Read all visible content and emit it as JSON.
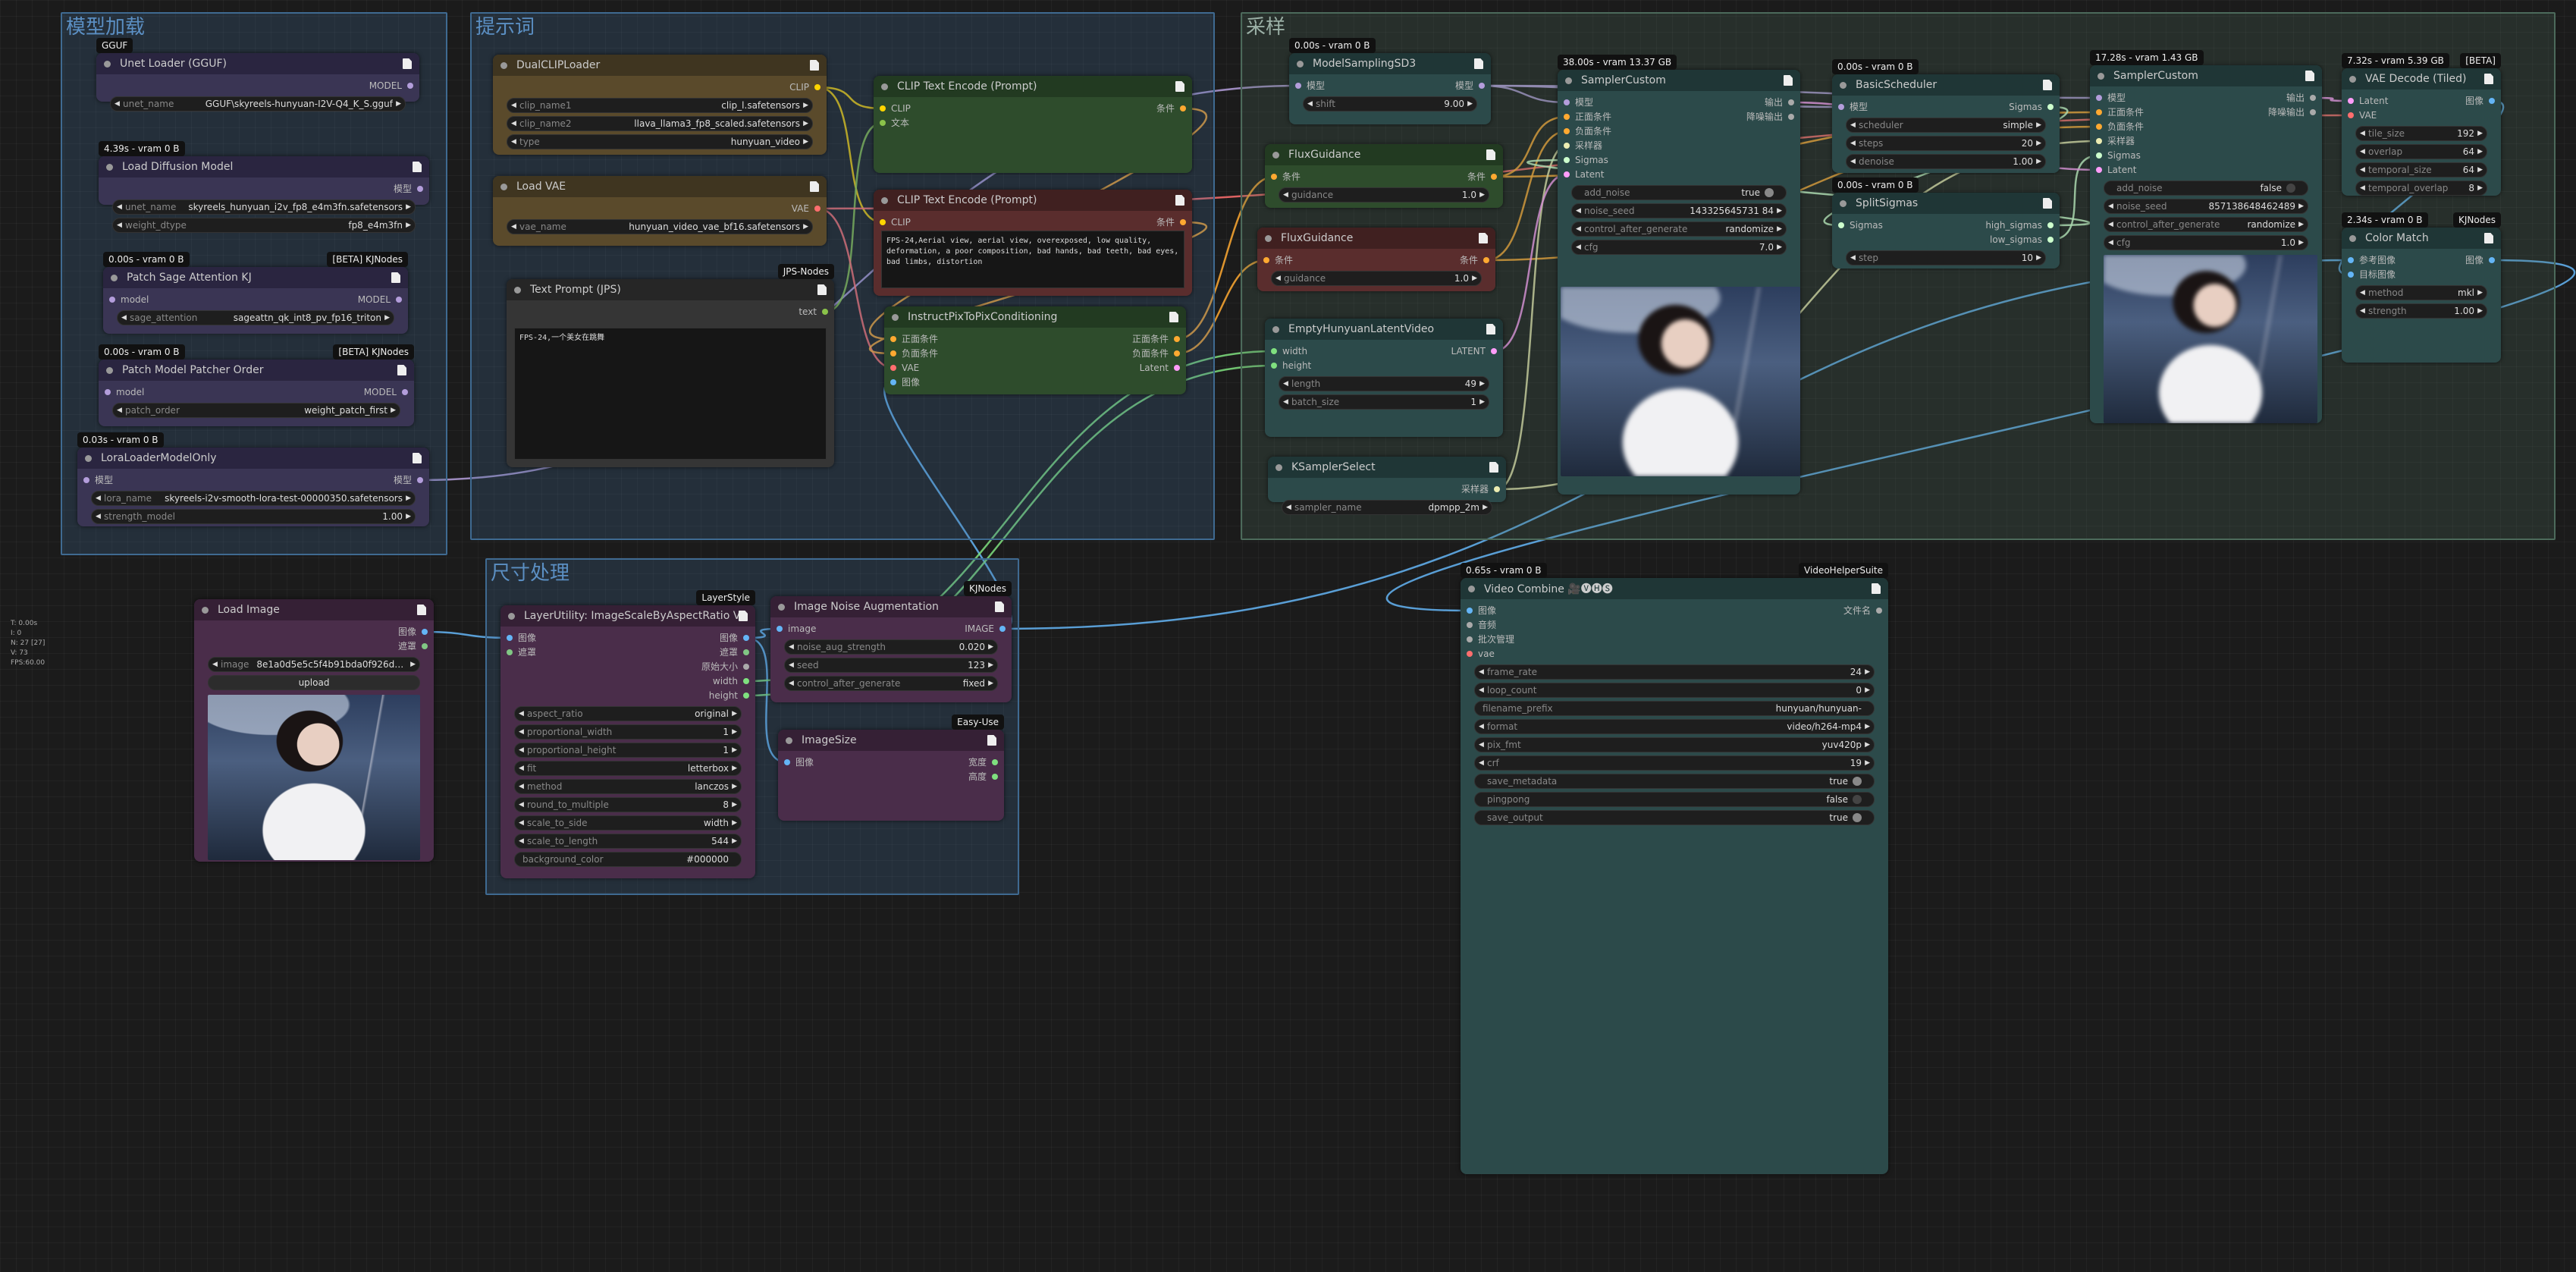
{
  "groups": [
    {
      "id": "g1",
      "title": "模型加载",
      "color": "#3f6a91"
    },
    {
      "id": "g2",
      "title": "提示词",
      "color": "#3f6a91"
    },
    {
      "id": "g3",
      "title": "采样",
      "color": "#4c6a5b"
    },
    {
      "id": "g4",
      "title": "尺寸处理",
      "color": "#3f6a91"
    }
  ],
  "nodes": [
    {
      "key": "unet_loader",
      "title": "Unet Loader (GGUF)",
      "badge": "GGUF",
      "outputs": [
        "MODEL"
      ],
      "widgets": [
        {
          "name": "unet_name",
          "value": "GGUF\\skyreels-hunyuan-I2V-Q4_K_S.gguf"
        }
      ]
    },
    {
      "key": "load_diffusion",
      "title": "Load Diffusion Model",
      "badge": "4.39s - vram 0 B",
      "outputs": [
        "模型"
      ],
      "widgets": [
        {
          "name": "unet_name",
          "value": "skyreels_hunyuan_i2v_fp8_e4m3fn.safetensors"
        },
        {
          "name": "weight_dtype",
          "value": "fp8_e4m3fn"
        }
      ]
    },
    {
      "key": "patch_sage",
      "title": "Patch Sage Attention KJ",
      "badge": "0.00s - vram 0 B",
      "badge2": "[BETA] KJNodes",
      "inputs": [
        "model"
      ],
      "outputs": [
        "MODEL"
      ],
      "widgets": [
        {
          "name": "sage_attention",
          "value": "sageattn_qk_int8_pv_fp16_triton"
        }
      ]
    },
    {
      "key": "patch_order",
      "title": "Patch Model Patcher Order",
      "badge": "0.00s - vram 0 B",
      "badge2": "[BETA] KJNodes",
      "inputs": [
        "model"
      ],
      "outputs": [
        "MODEL"
      ],
      "widgets": [
        {
          "name": "patch_order",
          "value": "weight_patch_first"
        }
      ]
    },
    {
      "key": "lora",
      "title": "LoraLoaderModelOnly",
      "badge": "0.03s - vram 0 B",
      "inputs": [
        "模型"
      ],
      "outputs": [
        "模型"
      ],
      "widgets": [
        {
          "name": "lora_name",
          "value": "skyreels-i2v-smooth-lora-test-00000350.safetensors"
        },
        {
          "name": "strength_model",
          "value": "1.00"
        }
      ]
    },
    {
      "key": "dualclip",
      "title": "DualCLIPLoader",
      "outputs": [
        "CLIP"
      ],
      "widgets": [
        {
          "name": "clip_name1",
          "value": "clip_l.safetensors"
        },
        {
          "name": "clip_name2",
          "value": "llava_llama3_fp8_scaled.safetensors"
        },
        {
          "name": "type",
          "value": "hunyuan_video"
        }
      ]
    },
    {
      "key": "load_vae",
      "title": "Load VAE",
      "outputs": [
        "VAE"
      ],
      "widgets": [
        {
          "name": "vae_name",
          "value": "hunyuan_video_vae_bf16.safetensors"
        }
      ]
    },
    {
      "key": "text_prompt",
      "title": "Text Prompt (JPS)",
      "badge2": "JPS-Nodes",
      "outputs": [
        "text"
      ],
      "text": "FPS-24,一个美女在跳舞"
    },
    {
      "key": "clip_pos",
      "title": "CLIP Text Encode (Prompt)",
      "inputs": [
        "CLIP",
        "文本"
      ],
      "outputs": [
        "条件"
      ]
    },
    {
      "key": "clip_neg",
      "title": "CLIP Text Encode (Prompt)",
      "inputs": [
        "CLIP"
      ],
      "outputs": [
        "条件"
      ],
      "text": "FPS-24,Aerial view, aerial view, overexposed, low quality, deformation, a poor composition, bad hands, bad teeth, bad eyes, bad limbs, distortion"
    },
    {
      "key": "instruct",
      "title": "InstructPixToPixConditioning",
      "inputs": [
        "正面条件",
        "负面条件",
        "VAE",
        "图像"
      ],
      "outputs": [
        "正面条件",
        "负面条件",
        "Latent"
      ]
    },
    {
      "key": "msd3",
      "title": "ModelSamplingSD3",
      "badge": "0.00s - vram 0 B",
      "inputs": [
        "模型"
      ],
      "outputs": [
        "模型"
      ],
      "widgets": [
        {
          "name": "shift",
          "value": "9.00"
        }
      ]
    },
    {
      "key": "flux1",
      "title": "FluxGuidance",
      "inputs": [
        "条件"
      ],
      "outputs": [
        "条件"
      ],
      "widgets": [
        {
          "name": "guidance",
          "value": "1.0"
        }
      ]
    },
    {
      "key": "flux2",
      "title": "FluxGuidance",
      "inputs": [
        "条件"
      ],
      "outputs": [
        "条件"
      ],
      "widgets": [
        {
          "name": "guidance",
          "value": "1.0"
        }
      ]
    },
    {
      "key": "empty_latent",
      "title": "EmptyHunyuanLatentVideo",
      "inputs": [
        "width",
        "height"
      ],
      "outputs": [
        "LATENT"
      ],
      "widgets": [
        {
          "name": "length",
          "value": "49"
        },
        {
          "name": "batch_size",
          "value": "1"
        }
      ]
    },
    {
      "key": "ksel",
      "title": "KSamplerSelect",
      "outputs": [
        "采样器"
      ],
      "widgets": [
        {
          "name": "sampler_name",
          "value": "dpmpp_2m"
        }
      ]
    },
    {
      "key": "sc1",
      "title": "SamplerCustom",
      "badge": "38.00s - vram 13.37 GB",
      "inputs": [
        "模型",
        "正面条件",
        "负面条件",
        "采样器",
        "Sigmas",
        "Latent"
      ],
      "outputs": [
        "输出",
        "降噪输出"
      ],
      "widgets": [
        {
          "name": "add_noise",
          "value": "true",
          "toggle": true
        },
        {
          "name": "noise_seed",
          "value": "143325645731 84"
        },
        {
          "name": "control_after_generate",
          "value": "randomize"
        },
        {
          "name": "cfg",
          "value": "7.0"
        }
      ]
    },
    {
      "key": "bsched",
      "title": "BasicScheduler",
      "badge": "0.00s - vram 0 B",
      "inputs": [
        "模型"
      ],
      "outputs": [
        "Sigmas"
      ],
      "widgets": [
        {
          "name": "scheduler",
          "value": "simple"
        },
        {
          "name": "steps",
          "value": "20"
        },
        {
          "name": "denoise",
          "value": "1.00"
        }
      ]
    },
    {
      "key": "split",
      "title": "SplitSigmas",
      "badge": "0.00s - vram 0 B",
      "inputs": [
        "Sigmas"
      ],
      "outputs": [
        "high_sigmas",
        "low_sigmas"
      ],
      "widgets": [
        {
          "name": "step",
          "value": "10"
        }
      ]
    },
    {
      "key": "sc2",
      "title": "SamplerCustom",
      "badge": "17.28s - vram 1.43 GB",
      "inputs": [
        "模型",
        "正面条件",
        "负面条件",
        "采样器",
        "Sigmas",
        "Latent"
      ],
      "outputs": [
        "输出",
        "降噪输出"
      ],
      "widgets": [
        {
          "name": "add_noise",
          "value": "false",
          "toggle": true,
          "off": true
        },
        {
          "name": "noise_seed",
          "value": "857138648462489"
        },
        {
          "name": "control_after_generate",
          "value": "randomize"
        },
        {
          "name": "cfg",
          "value": "1.0"
        }
      ]
    },
    {
      "key": "vae_dec",
      "title": "VAE Decode (Tiled)",
      "badge": "7.32s - vram 5.39 GB",
      "badge2": "[BETA]",
      "inputs": [
        "Latent",
        "VAE"
      ],
      "outputs": [
        "图像"
      ],
      "widgets": [
        {
          "name": "tile_size",
          "value": "192"
        },
        {
          "name": "overlap",
          "value": "64"
        },
        {
          "name": "temporal_size",
          "value": "64"
        },
        {
          "name": "temporal_overlap",
          "value": "8"
        }
      ]
    },
    {
      "key": "color_match",
      "title": "Color Match",
      "badge": "2.34s - vram 0 B",
      "badge2": "KJNodes",
      "inputs": [
        "参考图像",
        "目标图像"
      ],
      "outputs": [
        "图像"
      ],
      "widgets": [
        {
          "name": "method",
          "value": "mkl"
        },
        {
          "name": "strength",
          "value": "1.00"
        }
      ]
    },
    {
      "key": "load_image",
      "title": "Load Image",
      "inputs": [],
      "outputs": [
        "图像",
        "遮罩"
      ],
      "widgets": [
        {
          "name": "image",
          "value": "8e1a0d5e5c5f4b91bda0f926dbd5..."
        }
      ],
      "button": "upload"
    },
    {
      "key": "layer_scale",
      "title": "LayerUtility: ImageScaleByAspectRatio V2",
      "badge2": "LayerStyle",
      "inputs": [
        "图像",
        "遮罩"
      ],
      "outputs": [
        "图像",
        "遮罩",
        "原始大小",
        "width",
        "height"
      ],
      "widgets": [
        {
          "name": "aspect_ratio",
          "value": "original"
        },
        {
          "name": "proportional_width",
          "value": "1"
        },
        {
          "name": "proportional_height",
          "value": "1"
        },
        {
          "name": "fit",
          "value": "letterbox"
        },
        {
          "name": "method",
          "value": "lanczos"
        },
        {
          "name": "round_to_multiple",
          "value": "8"
        },
        {
          "name": "scale_to_side",
          "value": "width"
        },
        {
          "name": "scale_to_length",
          "value": "544"
        },
        {
          "name": "background_color",
          "value": "#000000",
          "plain": true
        }
      ]
    },
    {
      "key": "noise_aug",
      "title": "Image Noise Augmentation",
      "badge2": "KJNodes",
      "inputs": [
        "image"
      ],
      "outputs": [
        "IMAGE"
      ],
      "widgets": [
        {
          "name": "noise_aug_strength",
          "value": "0.020"
        },
        {
          "name": "seed",
          "value": "123"
        },
        {
          "name": "control_after_generate",
          "value": "fixed"
        }
      ]
    },
    {
      "key": "image_size",
      "title": "ImageSize",
      "badge2": "Easy-Use",
      "inputs": [
        "图像"
      ],
      "outputs": [
        "宽度",
        "高度"
      ]
    },
    {
      "key": "video_combine",
      "title": "Video Combine 🎥🅥🅗🅢",
      "badge": "0.65s - vram 0 B",
      "badge2": "VideoHelperSuite",
      "inputs": [
        "图像",
        "音频",
        "批次管理",
        "vae"
      ],
      "outputs": [
        "文件名"
      ],
      "widgets": [
        {
          "name": "frame_rate",
          "value": "24"
        },
        {
          "name": "loop_count",
          "value": "0"
        },
        {
          "name": "filename_prefix",
          "value": "hunyuan/hunyuan-",
          "plain": true
        },
        {
          "name": "format",
          "value": "video/h264-mp4"
        },
        {
          "name": "pix_fmt",
          "value": "yuv420p"
        },
        {
          "name": "crf",
          "value": "19"
        },
        {
          "name": "save_metadata",
          "value": "true",
          "toggle": true
        },
        {
          "name": "pingpong",
          "value": "false",
          "toggle": true,
          "off": true
        },
        {
          "name": "save_output",
          "value": "true",
          "toggle": true
        }
      ]
    }
  ],
  "stats": "T: 0.00s\nI: 0\nN: 27 [27]\nV: 73\nFPS:60.00",
  "colors": {
    "bg": "#1b1b1b",
    "group_blue": "#3f6a91",
    "group_green": "#4c6a5b"
  }
}
